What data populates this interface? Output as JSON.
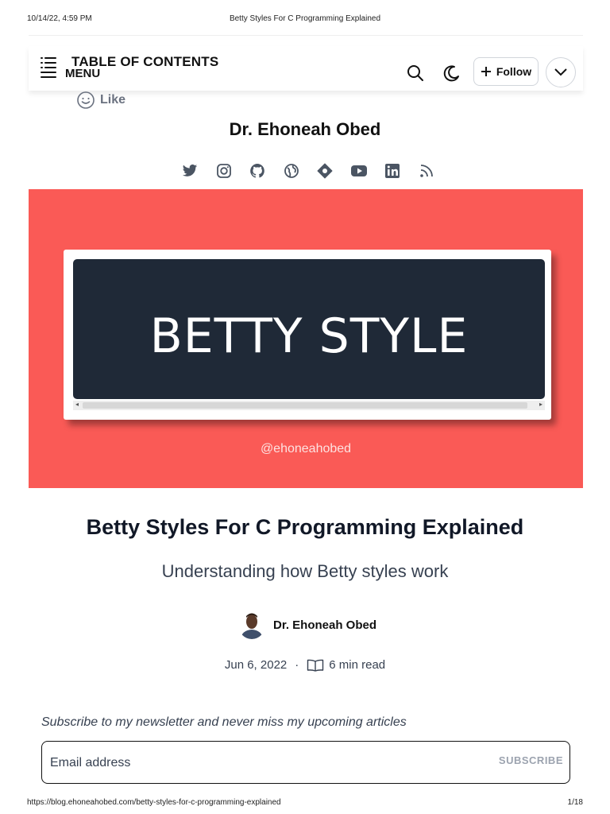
{
  "print": {
    "date": "10/14/22, 4:59 PM",
    "page_title": "Betty Styles For C Programming Explained",
    "url": "https://blog.ehoneahobed.com/betty-styles-for-c-programming-explained",
    "page_number": "1/18"
  },
  "navbar": {
    "toc_label": "TABLE OF CONTENTS",
    "menu_label": "MENU",
    "follow_label": "Follow"
  },
  "like_label": "Like",
  "blog_title": "Dr. Ehoneah Obed",
  "social_icons": [
    "twitter-icon",
    "instagram-icon",
    "github-icon",
    "globe-icon",
    "hashnode-icon",
    "youtube-icon",
    "linkedin-icon",
    "rss-icon"
  ],
  "cover": {
    "background": "#fa5a56",
    "title": "BETTY STYLE",
    "handle": "@ehoneahobed"
  },
  "article": {
    "title": "Betty Styles For C Programming Explained",
    "subtitle": "Understanding how Betty styles work",
    "author": "Dr. Ehoneah Obed",
    "date": "Jun 6, 2022",
    "separator": "·",
    "read_time": "6 min read"
  },
  "newsletter": {
    "prompt": "Subscribe to my newsletter and never miss my upcoming articles",
    "placeholder": "Email address",
    "button_label": "SUBSCRIBE"
  }
}
